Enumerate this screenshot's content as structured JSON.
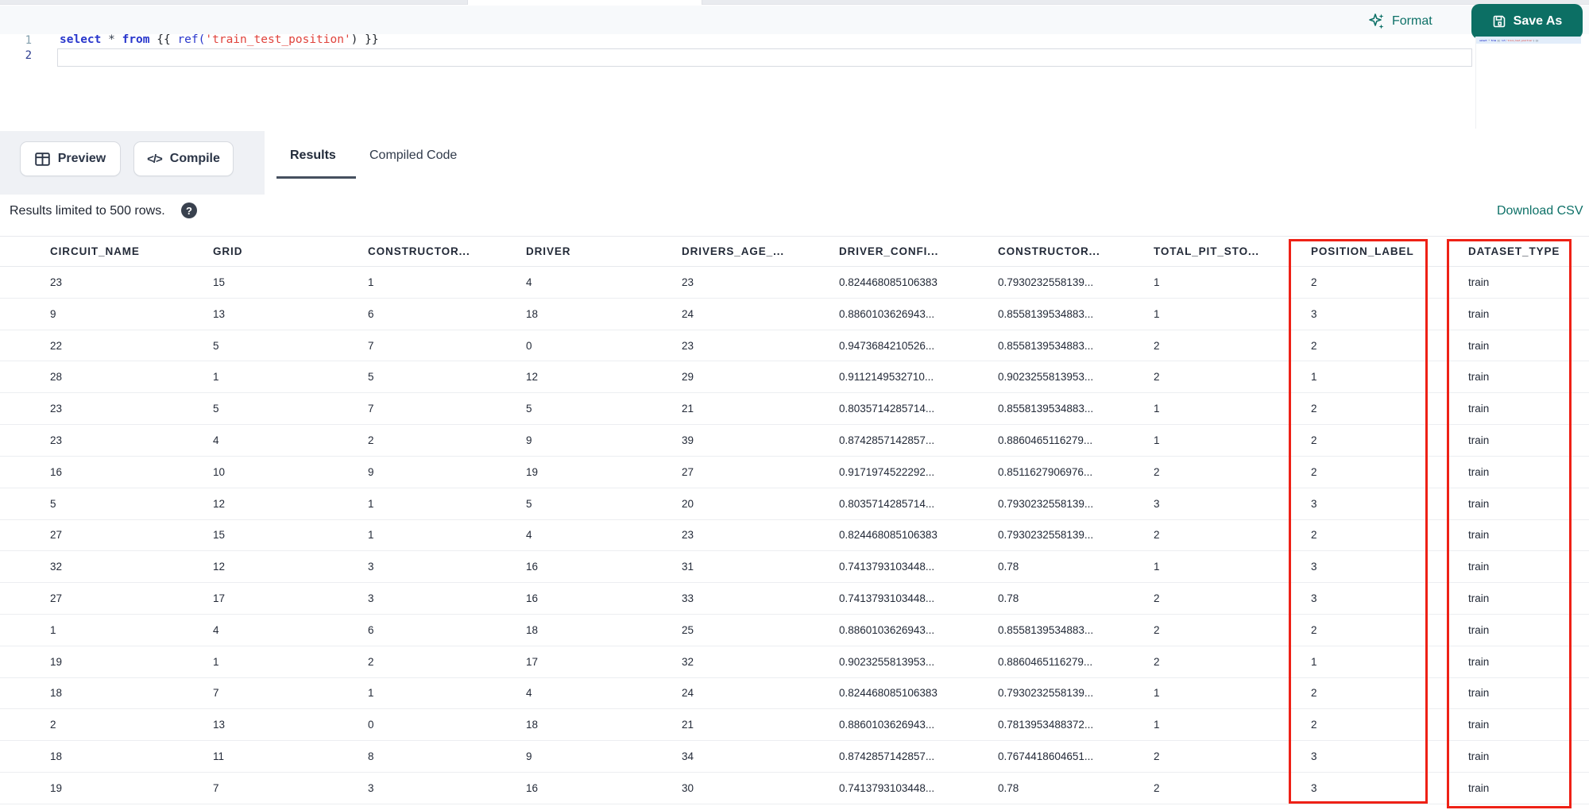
{
  "colors": {
    "accent_teal": "#0e7168",
    "annotation_red": "#ee2116"
  },
  "editor": {
    "line_numbers": [
      "1",
      "2"
    ],
    "code_text": "select * from {{ ref('train_test_position') }}",
    "code_tokens": [
      {
        "t": "select",
        "c": "kw"
      },
      {
        "t": " ",
        "c": "pl"
      },
      {
        "t": "*",
        "c": "op"
      },
      {
        "t": " ",
        "c": "pl"
      },
      {
        "t": "from",
        "c": "kw"
      },
      {
        "t": " ",
        "c": "pl"
      },
      {
        "t": "{{ ",
        "c": "pl"
      },
      {
        "t": "ref(",
        "c": "fn"
      },
      {
        "t": "'train_test_position'",
        "c": "str"
      },
      {
        "t": ")",
        "c": "pl"
      },
      {
        "t": " }}",
        "c": "pl"
      }
    ],
    "format_label": "Format",
    "save_as_label": "Save As"
  },
  "toolbar": {
    "preview_label": "Preview",
    "compile_label": "Compile",
    "compile_glyph": "</>",
    "tabs": [
      {
        "label": "Results",
        "active": true
      },
      {
        "label": "Compiled Code",
        "active": false
      }
    ]
  },
  "results": {
    "limit_note": "Results limited to 500 rows.",
    "help_glyph": "?",
    "download_label": "Download CSV"
  },
  "table": {
    "columns": [
      "CIRCUIT_NAME",
      "GRID",
      "CONSTRUCTOR...",
      "DRIVER",
      "DRIVERS_AGE_...",
      "DRIVER_CONFI...",
      "CONSTRUCTOR...",
      "TOTAL_PIT_STO...",
      "POSITION_LABEL",
      "DATASET_TYPE"
    ],
    "highlighted_columns": [
      "POSITION_LABEL",
      "DATASET_TYPE"
    ],
    "rows": [
      [
        "23",
        "15",
        "1",
        "4",
        "23",
        "0.824468085106383",
        "0.7930232558139...",
        "1",
        "2",
        "train"
      ],
      [
        "9",
        "13",
        "6",
        "18",
        "24",
        "0.8860103626943...",
        "0.8558139534883...",
        "1",
        "3",
        "train"
      ],
      [
        "22",
        "5",
        "7",
        "0",
        "23",
        "0.9473684210526...",
        "0.8558139534883...",
        "2",
        "2",
        "train"
      ],
      [
        "28",
        "1",
        "5",
        "12",
        "29",
        "0.9112149532710...",
        "0.9023255813953...",
        "2",
        "1",
        "train"
      ],
      [
        "23",
        "5",
        "7",
        "5",
        "21",
        "0.8035714285714...",
        "0.8558139534883...",
        "1",
        "2",
        "train"
      ],
      [
        "23",
        "4",
        "2",
        "9",
        "39",
        "0.8742857142857...",
        "0.8860465116279...",
        "1",
        "2",
        "train"
      ],
      [
        "16",
        "10",
        "9",
        "19",
        "27",
        "0.9171974522292...",
        "0.8511627906976...",
        "2",
        "2",
        "train"
      ],
      [
        "5",
        "12",
        "1",
        "5",
        "20",
        "0.8035714285714...",
        "0.7930232558139...",
        "3",
        "3",
        "train"
      ],
      [
        "27",
        "15",
        "1",
        "4",
        "23",
        "0.824468085106383",
        "0.7930232558139...",
        "2",
        "2",
        "train"
      ],
      [
        "32",
        "12",
        "3",
        "16",
        "31",
        "0.7413793103448...",
        "0.78",
        "1",
        "3",
        "train"
      ],
      [
        "27",
        "17",
        "3",
        "16",
        "33",
        "0.7413793103448...",
        "0.78",
        "2",
        "3",
        "train"
      ],
      [
        "1",
        "4",
        "6",
        "18",
        "25",
        "0.8860103626943...",
        "0.8558139534883...",
        "2",
        "2",
        "train"
      ],
      [
        "19",
        "1",
        "2",
        "17",
        "32",
        "0.9023255813953...",
        "0.8860465116279...",
        "2",
        "1",
        "train"
      ],
      [
        "18",
        "7",
        "1",
        "4",
        "24",
        "0.824468085106383",
        "0.7930232558139...",
        "1",
        "2",
        "train"
      ],
      [
        "2",
        "13",
        "0",
        "18",
        "21",
        "0.8860103626943...",
        "0.7813953488372...",
        "1",
        "2",
        "train"
      ],
      [
        "18",
        "11",
        "8",
        "9",
        "34",
        "0.8742857142857...",
        "0.7674418604651...",
        "2",
        "3",
        "train"
      ],
      [
        "19",
        "7",
        "3",
        "16",
        "30",
        "0.7413793103448...",
        "0.78",
        "2",
        "3",
        "train"
      ]
    ]
  }
}
